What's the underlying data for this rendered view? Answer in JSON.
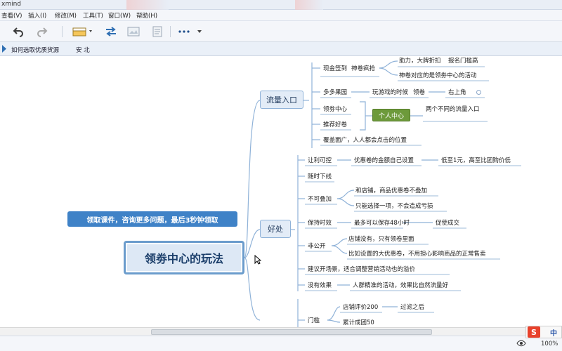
{
  "window": {
    "title": "xmind"
  },
  "menu": [
    "查看(V)",
    "插入(I)",
    "修改(M)",
    "工具(T)",
    "窗口(W)",
    "帮助(H)"
  ],
  "toolbar": {
    "undo_icon": "undo-icon",
    "redo_icon": "redo-icon",
    "style_icon": "style-icon",
    "relationship_icon": "relationship-icon",
    "more_icon": "more-icon"
  },
  "tab": {
    "title": "如何选取优质货源",
    "extra": "安 北"
  },
  "overlay": {
    "banner": "领取课件，咨询更多问题，最后3秒钟领取"
  },
  "mindmap": {
    "central": "领劵中心的玩法",
    "branch_traffic": {
      "label": "流量入口",
      "t1": "现金签到",
      "t1b": "神卷疯抢",
      "t1_a": "助力，大牌折扣",
      "t1_b": "报名门槛高",
      "t1_c": "神卷对应的是领劵中心的活动",
      "t2": "多多果园",
      "t2b": "玩游戏的时候",
      "t2c": "领卷",
      "t2d": "右上角",
      "t3": "领劵中心",
      "t4": "推荐好卷",
      "t_green": "个人中心",
      "t_green_note": "两个不同的流量入口",
      "t5": "覆盖面广，人人都会点击的位置"
    },
    "branch_benefit": {
      "label": "好处",
      "b1": "让利可控",
      "b1a": "优惠卷的金额自己设置",
      "b1b": "低至1元，高至比团购价低",
      "b2": "随时下线",
      "b3": "不可叠加",
      "b3a": "和店铺，商品优惠卷不叠加",
      "b3b": "只能选择一项，不会造成亏损",
      "b4": "保持时效",
      "b4a": "最多可以保存48小时",
      "b4b": "促使成交",
      "b5": "非公开",
      "b5a": "店铺没有，只有领卷里面",
      "b5b": "比如设置的大优惠卷，不用担心影响商品的正常售卖",
      "b6": "建议开场景，适合调整营销活动也的溢价",
      "b7": "没有效果",
      "b7a": "人群精准的活动，效果比自然流量好"
    },
    "branch_threshold": {
      "label": "门槛",
      "m1": "店铺评价200",
      "m1b": "过滤之后",
      "m2": "累计成团50"
    }
  },
  "status": {
    "zoom": "100%",
    "ime_lang": "中"
  },
  "colors": {
    "accent": "#3f82c7",
    "green": "#6d9a3b",
    "line": "#8fb2d8"
  }
}
